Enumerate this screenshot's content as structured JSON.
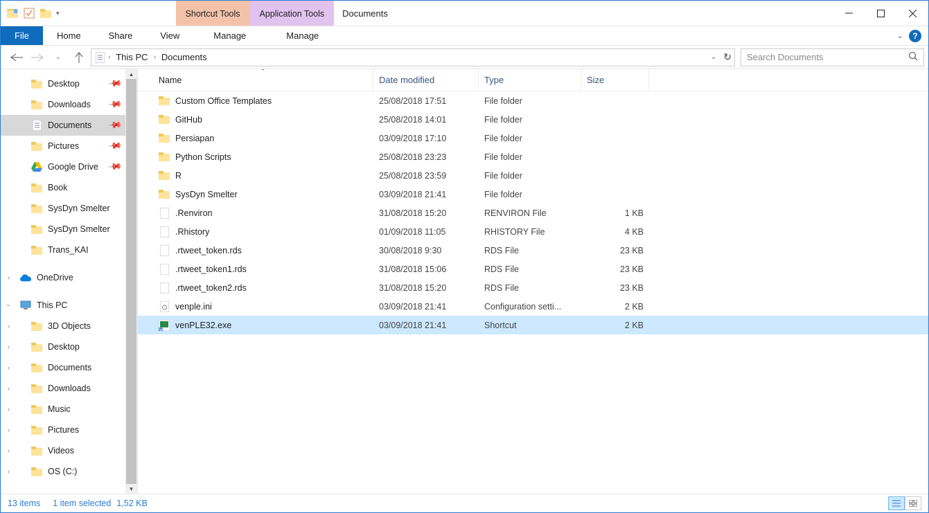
{
  "title": "Documents",
  "contextual_tabs": [
    {
      "label": "Shortcut Tools",
      "sub": "Manage",
      "class": "shortcut"
    },
    {
      "label": "Application Tools",
      "sub": "Manage",
      "class": "app"
    }
  ],
  "ribbon_tabs": {
    "file": "File",
    "home": "Home",
    "share": "Share",
    "view": "View"
  },
  "breadcrumb": [
    "This PC",
    "Documents"
  ],
  "search_placeholder": "Search Documents",
  "nav": {
    "quick": [
      {
        "label": "Desktop",
        "pinned": true,
        "icon": "folder"
      },
      {
        "label": "Downloads",
        "pinned": true,
        "icon": "folder"
      },
      {
        "label": "Documents",
        "pinned": true,
        "icon": "doc",
        "selected": true
      },
      {
        "label": "Pictures",
        "pinned": true,
        "icon": "folder"
      },
      {
        "label": "Google Drive",
        "pinned": true,
        "icon": "gdrive"
      },
      {
        "label": "Book",
        "pinned": false,
        "icon": "folder"
      },
      {
        "label": "SysDyn Smelter",
        "pinned": false,
        "icon": "folder"
      },
      {
        "label": "SysDyn Smelter",
        "pinned": false,
        "icon": "folder"
      },
      {
        "label": "Trans_KAI",
        "pinned": false,
        "icon": "folder"
      }
    ],
    "onedrive": "OneDrive",
    "thispc": "This PC",
    "thispc_children": [
      {
        "label": "3D Objects"
      },
      {
        "label": "Desktop"
      },
      {
        "label": "Documents"
      },
      {
        "label": "Downloads"
      },
      {
        "label": "Music"
      },
      {
        "label": "Pictures"
      },
      {
        "label": "Videos"
      },
      {
        "label": "OS (C:)"
      }
    ]
  },
  "columns": {
    "name": "Name",
    "date": "Date modified",
    "type": "Type",
    "size": "Size"
  },
  "files": [
    {
      "name": "Custom Office Templates",
      "date": "25/08/2018 17:51",
      "type": "File folder",
      "size": "",
      "icon": "folder"
    },
    {
      "name": "GitHub",
      "date": "25/08/2018 14:01",
      "type": "File folder",
      "size": "",
      "icon": "folder"
    },
    {
      "name": "Persiapan",
      "date": "03/09/2018 17:10",
      "type": "File folder",
      "size": "",
      "icon": "folder"
    },
    {
      "name": "Python Scripts",
      "date": "25/08/2018 23:23",
      "type": "File folder",
      "size": "",
      "icon": "folder"
    },
    {
      "name": "R",
      "date": "25/08/2018 23:59",
      "type": "File folder",
      "size": "",
      "icon": "folder"
    },
    {
      "name": "SysDyn Smelter",
      "date": "03/09/2018 21:41",
      "type": "File folder",
      "size": "",
      "icon": "folder"
    },
    {
      "name": ".Renviron",
      "date": "31/08/2018 15:20",
      "type": "RENVIRON File",
      "size": "1 KB",
      "icon": "file"
    },
    {
      "name": ".Rhistory",
      "date": "01/09/2018 11:05",
      "type": "RHISTORY File",
      "size": "4 KB",
      "icon": "file"
    },
    {
      "name": ".rtweet_token.rds",
      "date": "30/08/2018 9:30",
      "type": "RDS File",
      "size": "23 KB",
      "icon": "file"
    },
    {
      "name": ".rtweet_token1.rds",
      "date": "31/08/2018 15:06",
      "type": "RDS File",
      "size": "23 KB",
      "icon": "file"
    },
    {
      "name": ".rtweet_token2.rds",
      "date": "31/08/2018 15:20",
      "type": "RDS File",
      "size": "23 KB",
      "icon": "file"
    },
    {
      "name": "venple.ini",
      "date": "03/09/2018 21:41",
      "type": "Configuration setti...",
      "size": "2 KB",
      "icon": "ini"
    },
    {
      "name": "venPLE32.exe",
      "date": "03/09/2018 21:41",
      "type": "Shortcut",
      "size": "2 KB",
      "icon": "shortcut",
      "selected": true
    }
  ],
  "status": {
    "items": "13 items",
    "selected": "1 item selected",
    "size": "1,52 KB"
  }
}
